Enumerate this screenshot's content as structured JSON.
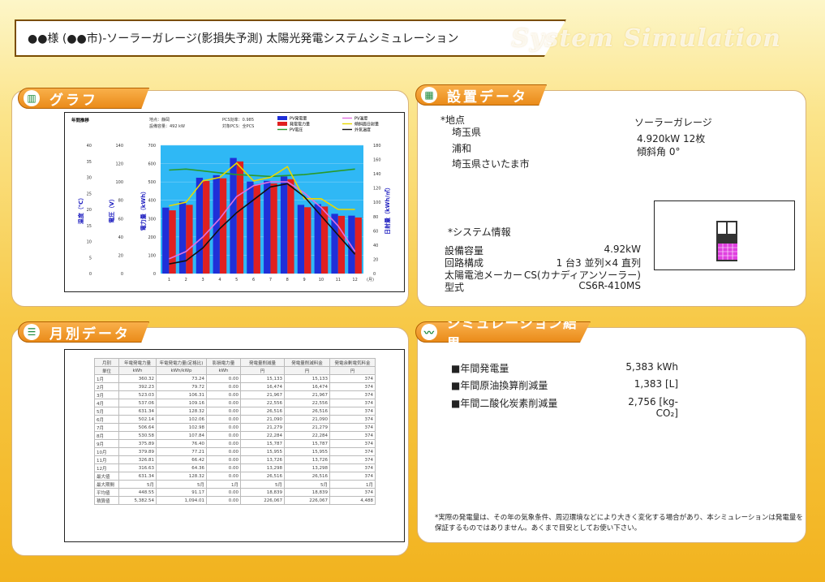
{
  "header": {
    "title": "●●様 (●●市)-ソーラーガレージ(影損失予測)  太陽光発電システムシミュレーション",
    "brand": "System Simulation"
  },
  "graph_tab": {
    "label": "グラフ"
  },
  "setting_tab": {
    "label": "設置データ"
  },
  "monthly_tab": {
    "label": "月別データ"
  },
  "result_tab": {
    "label": "シミュレーション結果"
  },
  "graph_info": {
    "title": "年間推移",
    "loc": "地点：静岡",
    "cap": "設備容量：492 kW",
    "eff": "PCS効率：0.985",
    "pcs": "対象PCS：全PCS"
  },
  "chart_data": {
    "type": "bar",
    "categories": [
      "1",
      "2",
      "3",
      "4",
      "5",
      "6",
      "7",
      "8",
      "9",
      "10",
      "11",
      "12"
    ],
    "xunit": "(月)",
    "series": [
      {
        "name": "PV発電量",
        "kind": "bar",
        "color": "#1f2fd8",
        "values": [
          360,
          392,
          523,
          537,
          631,
          502,
          506,
          530,
          375,
          379,
          326,
          316
        ]
      },
      {
        "name": "発電電力量",
        "kind": "bar",
        "color": "#e02020",
        "values": [
          345,
          375,
          505,
          520,
          612,
          485,
          492,
          515,
          362,
          366,
          315,
          306
        ]
      },
      {
        "name": "PV電圧",
        "kind": "line",
        "color": "#2a9a2a",
        "values": [
          113,
          114,
          112,
          110,
          108,
          107,
          106,
          107,
          108,
          110,
          112,
          114
        ]
      },
      {
        "name": "PV温度",
        "kind": "line",
        "color": "#e070e0",
        "values": [
          8,
          12,
          20,
          30,
          42,
          48,
          50,
          50,
          44,
          36,
          26,
          12
        ]
      },
      {
        "name": "傾斜面日射量",
        "kind": "line",
        "color": "#e8d800",
        "values": [
          95,
          100,
          130,
          135,
          155,
          130,
          135,
          150,
          105,
          105,
          90,
          90
        ]
      },
      {
        "name": "外気温度",
        "kind": "line",
        "color": "#111111",
        "values": [
          3,
          4,
          8,
          14,
          19,
          23,
          27,
          28,
          24,
          18,
          12,
          6
        ]
      }
    ],
    "axes": {
      "temp": {
        "label": "温度（℃）",
        "ticks": [
          "0",
          "5",
          "10",
          "15",
          "20",
          "25",
          "30",
          "35",
          "40"
        ]
      },
      "volt": {
        "label": "電圧（V）",
        "ticks": [
          "0",
          "20",
          "40",
          "60",
          "80",
          "100",
          "120",
          "140"
        ]
      },
      "power": {
        "label": "電力量（kWh）",
        "ticks": [
          "0",
          "100",
          "200",
          "300",
          "400",
          "500",
          "600",
          "700"
        ],
        "ylim": [
          0,
          700
        ]
      },
      "irr": {
        "label": "日射量（kWh/㎡）",
        "ticks": [
          "0",
          "20",
          "40",
          "60",
          "80",
          "100",
          "120",
          "140",
          "160",
          "180"
        ]
      }
    }
  },
  "monthly": {
    "headers": [
      "月別",
      "年電発電力量",
      "年電発電力量(定格比)",
      "影損電力量",
      "発電量削減量",
      "発電量削減料金",
      "発電余剰電気料金"
    ],
    "units": [
      "単位",
      "kWh",
      "kWh/kWp",
      "kWh",
      "円",
      "円",
      "円"
    ],
    "rows": [
      [
        "1月",
        "360.32",
        "73.24",
        "0.00",
        "15,133",
        "15,133",
        "374"
      ],
      [
        "2月",
        "392.23",
        "79.72",
        "0.00",
        "16,474",
        "16,474",
        "374"
      ],
      [
        "3月",
        "523.03",
        "106.31",
        "0.00",
        "21,967",
        "21,967",
        "374"
      ],
      [
        "4月",
        "537.06",
        "109.16",
        "0.00",
        "22,556",
        "22,556",
        "374"
      ],
      [
        "5月",
        "631.34",
        "128.32",
        "0.00",
        "26,516",
        "26,516",
        "374"
      ],
      [
        "6月",
        "502.14",
        "102.06",
        "0.00",
        "21,090",
        "21,090",
        "374"
      ],
      [
        "7月",
        "506.64",
        "102.98",
        "0.00",
        "21,279",
        "21,279",
        "374"
      ],
      [
        "8月",
        "530.58",
        "107.84",
        "0.00",
        "22,284",
        "22,284",
        "374"
      ],
      [
        "9月",
        "375.89",
        "76.40",
        "0.00",
        "15,787",
        "15,787",
        "374"
      ],
      [
        "10月",
        "379.89",
        "77.21",
        "0.00",
        "15,955",
        "15,955",
        "374"
      ],
      [
        "11月",
        "326.81",
        "66.42",
        "0.00",
        "13,726",
        "13,726",
        "374"
      ],
      [
        "12月",
        "316.63",
        "64.36",
        "0.00",
        "13,298",
        "13,298",
        "374"
      ],
      [
        "最大値",
        "631.34",
        "128.32",
        "0.00",
        "26,516",
        "26,516",
        "374"
      ],
      [
        "最大期間",
        "5月",
        "5月",
        "1月",
        "5月",
        "5月",
        "1月"
      ],
      [
        "平均値",
        "448.55",
        "91.17",
        "0.00",
        "18,839",
        "18,839",
        "374"
      ],
      [
        "積算値",
        "5,382.54",
        "1,094.01",
        "0.00",
        "226,067",
        "226,067",
        "4,488"
      ]
    ]
  },
  "setting": {
    "loc_label": "*地点",
    "pref": "埼玉県",
    "city": "浦和",
    "addr": "埼玉県さいたま市",
    "type": "ソーラーガレージ",
    "spec": "4.920kW  12枚",
    "tilt": "傾斜角  0°",
    "sys_label": "*システム情報",
    "rows": [
      {
        "k": "設備容量",
        "v": "4.92kW"
      },
      {
        "k": "回路構成",
        "v": "1 台3 並列×4 直列"
      },
      {
        "k": "太陽電池メーカー",
        "v": "CS(カナディアンソーラー)"
      },
      {
        "k": "型式",
        "v": "CS6R-410MS"
      }
    ]
  },
  "results": {
    "rows": [
      {
        "k": "■年間発電量",
        "v": "5,383 kWh"
      },
      {
        "k": "■年間原油換算削減量",
        "v": "1,383 [L]"
      },
      {
        "k": "■年間二酸化炭素削減量",
        "v": "2,756 [kg-CO₂]"
      }
    ],
    "note": "*実際の発電量は、その年の気象条件、周辺環境などにより大きく変化する場合があり、本シミュレーションは発電量を保証するものではありません。あくまで目安としてお使い下さい。"
  }
}
